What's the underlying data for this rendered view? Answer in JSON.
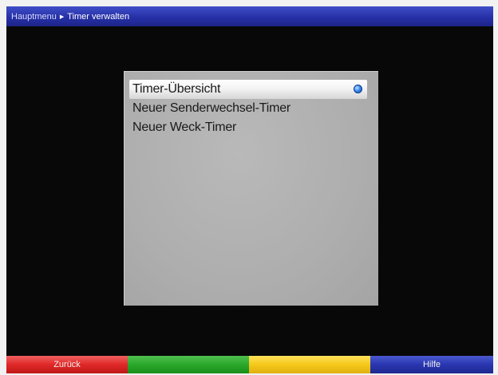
{
  "header": {
    "breadcrumb": [
      "Hauptmenu",
      "Timer verwalten"
    ],
    "separator_icon": "triangle-right-icon"
  },
  "menu": {
    "items": [
      {
        "label": "Timer-Übersicht",
        "selected": true
      },
      {
        "label": "Neuer Senderwechsel-Timer",
        "selected": false
      },
      {
        "label": "Neuer Weck-Timer",
        "selected": false
      }
    ],
    "selected_indicator_icon": "ok-bullet-icon"
  },
  "footer": {
    "keys": [
      {
        "color": "red",
        "label": "Zurück"
      },
      {
        "color": "green",
        "label": ""
      },
      {
        "color": "yellow",
        "label": ""
      },
      {
        "color": "blue",
        "label": "Hilfe"
      }
    ]
  },
  "colors": {
    "title_bar": "#2630a6",
    "panel": "#b0b0b0",
    "background": "#080808",
    "red_key": "#e02828",
    "green_key": "#2aa82a",
    "yellow_key": "#f5c81a",
    "blue_key": "#2a36b0"
  }
}
